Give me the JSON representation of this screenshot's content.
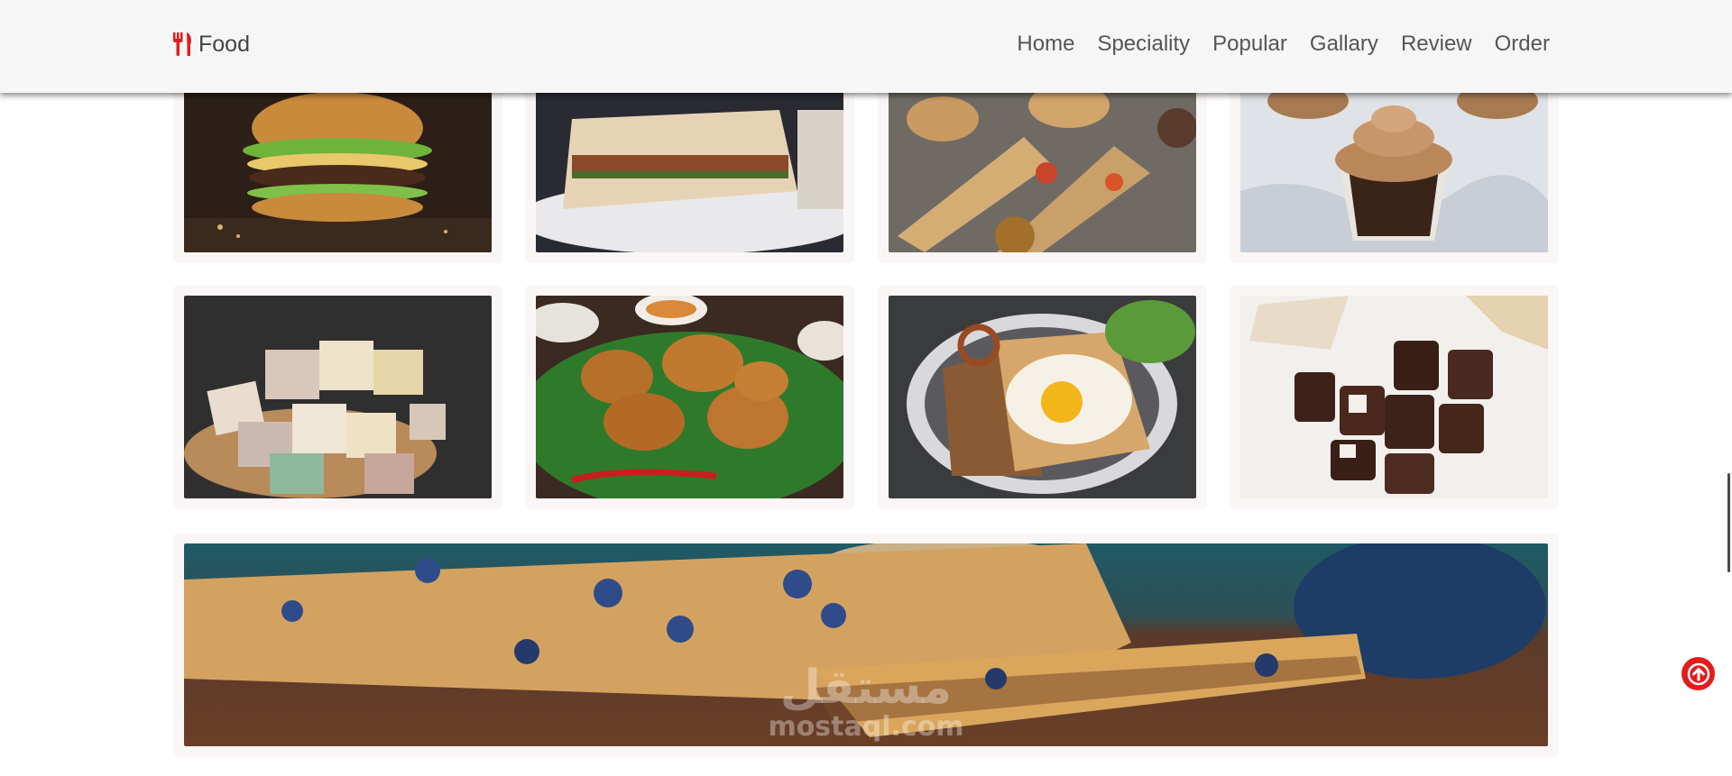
{
  "header": {
    "logo_text": "Food",
    "nav": [
      "Home",
      "Speciality",
      "Popular",
      "Gallary",
      "Review",
      "Order"
    ]
  },
  "gallery": {
    "images": [
      {
        "name": "burger-image",
        "icon": "burger"
      },
      {
        "name": "sandwich-image",
        "icon": "sandwich"
      },
      {
        "name": "wraps-image",
        "icon": "wraps"
      },
      {
        "name": "cupcake-image",
        "icon": "cupcake"
      },
      {
        "name": "soap-cubes-image",
        "icon": "cubes"
      },
      {
        "name": "fried-chicken-image",
        "icon": "fried-chicken"
      },
      {
        "name": "egg-toast-image",
        "icon": "egg-toast"
      },
      {
        "name": "chocolate-image",
        "icon": "chocolate"
      },
      {
        "name": "oat-bar-image",
        "icon": "oat-bar"
      }
    ]
  },
  "watermark": {
    "arabic": "مستقل",
    "latin": "mostaql.com"
  },
  "colors": {
    "accent": "#e31c1c",
    "header_bg": "#f6f6f6",
    "card_bg": "#fbf6f6"
  }
}
